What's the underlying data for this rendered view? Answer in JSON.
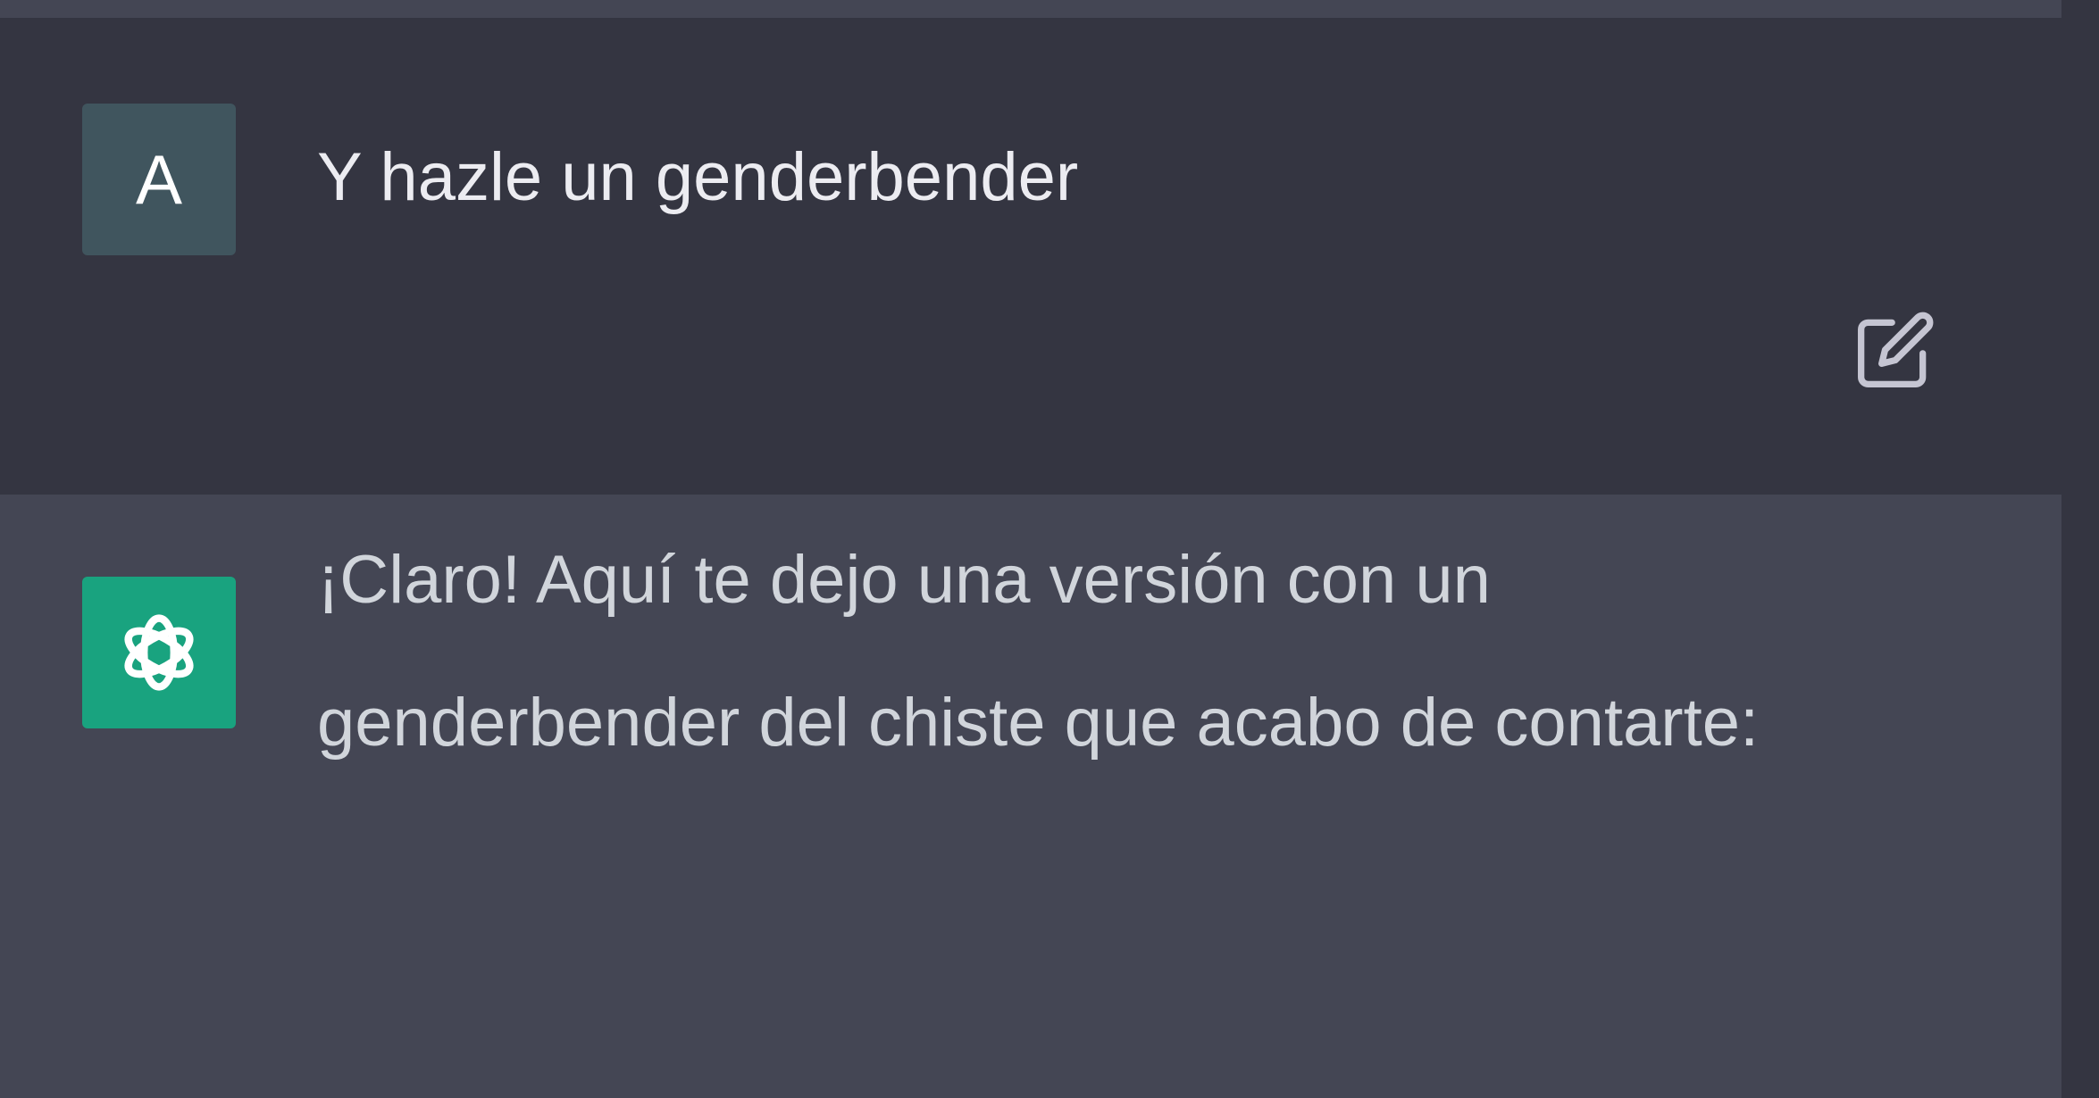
{
  "conversation": {
    "user_message": {
      "avatar_letter": "A",
      "text": "Y hazle un genderbender"
    },
    "assistant_message": {
      "avatar_icon": "openai-logo-icon",
      "text": "¡Claro! Aquí te dejo una versión con un genderbender del chiste que acabo de contarte:"
    }
  },
  "actions": {
    "edit_icon": "edit-icon"
  },
  "colors": {
    "user_bg": "#343541",
    "assistant_bg": "#444654",
    "user_avatar": "#40555e",
    "assistant_avatar": "#19a37f",
    "text": "#d1d5db"
  }
}
